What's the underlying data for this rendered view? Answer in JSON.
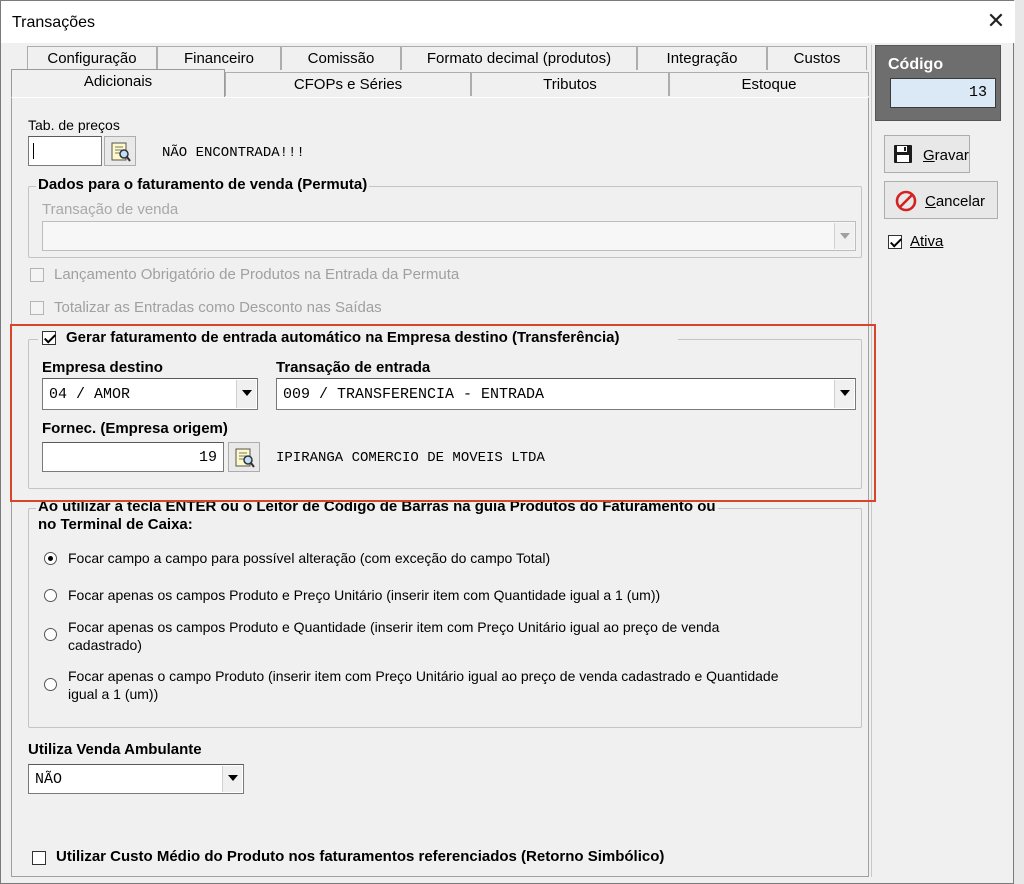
{
  "window": {
    "title": "Transações",
    "close_glyph": "✕"
  },
  "tabs": {
    "row1": [
      "Configuração",
      "Financeiro",
      "Comissão",
      "Formato decimal (produtos)",
      "Integração",
      "Custos"
    ],
    "row2": [
      "Adicionais",
      "CFOPs e Séries",
      "Tributos",
      "Estoque"
    ],
    "active": "Adicionais"
  },
  "codigo": {
    "label": "Código",
    "value": "13"
  },
  "actions": {
    "save": "Gravar",
    "cancel": "Cancelar",
    "ativa_label": "Ativa",
    "ativa_checked": true
  },
  "tab_precos": {
    "label": "Tab. de preços",
    "value": "",
    "status": "NÃO ENCONTRADA!!!"
  },
  "permuta": {
    "group_label": "Dados para o faturamento de venda (Permuta)",
    "transacao_label": "Transação de venda",
    "transacao_value": ""
  },
  "checks": {
    "lancamento": "Lançamento Obrigatório de Produtos na Entrada da Permuta",
    "totalizar": "Totalizar as Entradas como Desconto nas Saídas",
    "gerar": "Gerar faturamento de entrada automático na Empresa destino (Transferência)",
    "gerar_checked": true
  },
  "transferencia": {
    "empresa_label": "Empresa destino",
    "empresa_value": "04 / AMOR",
    "transacao_label": "Transação de entrada",
    "transacao_value": "009 / TRANSFERENCIA - ENTRADA",
    "fornec_label": "Fornec. (Empresa origem)",
    "fornec_value": "19",
    "fornec_name": "IPIRANGA COMERCIO DE MOVEIS LTDA"
  },
  "enter_group": {
    "label_line1": "Ao utilizar a tecla ENTER ou o Leitor de Código de Barras na guia Produtos do Faturamento ou",
    "label_line2": "no Terminal de Caixa:",
    "options": [
      {
        "line1": "Focar campo a campo para possível alteração (com exceção do campo Total)",
        "line2": ""
      },
      {
        "line1": "Focar apenas os campos Produto e Preço Unitário (inserir item com Quantidade igual a 1 (um))",
        "line2": ""
      },
      {
        "line1": "Focar apenas os campos Produto e Quantidade (inserir item com Preço Unitário igual ao preço de venda",
        "line2": "cadastrado)"
      },
      {
        "line1": "Focar apenas o campo Produto (inserir item com Preço Unitário igual ao preço de venda cadastrado e Quantidade",
        "line2": "igual a 1 (um))"
      }
    ],
    "selected": 0
  },
  "ambulante": {
    "label": "Utiliza Venda Ambulante",
    "value": "NÃO"
  },
  "custo_medio": {
    "label": "Utilizar Custo Médio do Produto nos faturamentos referenciados (Retorno Simbólico)",
    "checked": false
  },
  "icons": {
    "save": "floppy-disk-icon",
    "cancel": "no-entry-icon",
    "lookup": "lookup-search-icon"
  },
  "colors": {
    "highlight_border": "#d9452b",
    "codigo_panel": "#6e6e6e",
    "codigo_field": "#dbe8f6",
    "cancel_icon": "#d42020"
  }
}
